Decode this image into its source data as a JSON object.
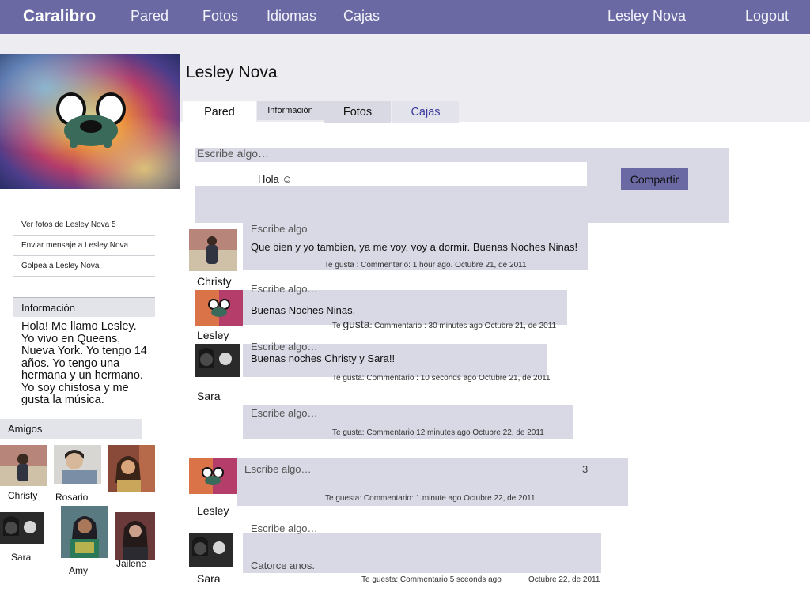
{
  "nav": {
    "brand": "Caralibro",
    "items": [
      "Pared",
      "Fotos",
      "Idiomas",
      "Cajas"
    ],
    "user": "Lesley Nova",
    "logout": "Logout"
  },
  "profile": {
    "name": "Lesley Nova",
    "tabs": [
      "Pared",
      "Información",
      "Fotos",
      "Cajas"
    ]
  },
  "composer": {
    "placeholder": "Escribe algo…",
    "value": "Hola ☺",
    "share": "Compartir"
  },
  "sidebar": {
    "links": [
      "Ver fotos de Lesley Nova 5",
      "Enviar mensaje a Lesley Nova",
      "Golpea a Lesley Nova"
    ],
    "info_title": "Información",
    "bio": "Hola! Me llamo Lesley. Yo vivo en Queens, Nueva York.  Yo tengo 14 años. Yo tengo una hermana y un hermano. Yo soy chistosa y me gusta la música.",
    "friends_title": "Amigos",
    "friends": [
      "Christy",
      "Rosario",
      "",
      "Sara",
      "Amy",
      "Jailene"
    ]
  },
  "posts": [
    {
      "author": "Christy",
      "placeholder": "Escribe algo",
      "text": "Que bien y yo tambien, ya me voy, voy a dormir. Buenas Noches Ninas!",
      "meta": "Te gusta : Commentario:      1 hour ago.     Octubre 21, de 2011"
    },
    {
      "author": "Lesley",
      "placeholder": "Escribe algo…",
      "text": "Buenas Noches Ninas.",
      "meta_pre": "Te ",
      "meta_big": "gusta",
      "meta": ": Commentario :    30 minutes ago   Octubre 21, de 2011"
    },
    {
      "author": "Sara",
      "placeholder": "Escribe algo…",
      "text": "Buenas noches Christy y Sara!!",
      "meta": "Te gusta:  Commentario  : 10 seconds ago   Octubre 21,  de 2011"
    },
    {
      "author": "",
      "placeholder": "Escribe algo…",
      "text": "",
      "meta": "Te gusta:      Commentario    12  minutes ago   Octubre 22, de 2011"
    },
    {
      "author": "Lesley",
      "placeholder": "Escribe algo…",
      "text": "",
      "count": "3",
      "meta": "Te guesta:      Commentario:     1 minute ago       Octubre 22, de 2011"
    },
    {
      "author": "Sara",
      "placeholder": "Escribe algo…",
      "text": "Catorce anos.",
      "meta": "Te guesta: Commentario 5 sceonds ago",
      "date": "Octubre 22, de 2011"
    }
  ]
}
